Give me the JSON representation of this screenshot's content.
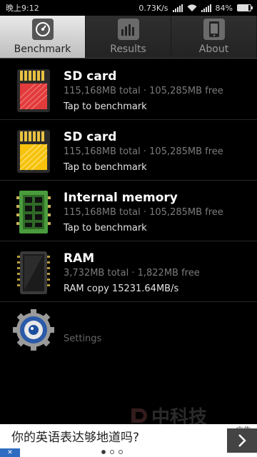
{
  "status_bar": {
    "time": "晚上9:12",
    "network_speed": "0.73K/s",
    "battery": "84%",
    "battery_level": 0.84
  },
  "tabs": [
    {
      "label": "Benchmark",
      "icon": "speedometer-icon",
      "active": true
    },
    {
      "label": "Results",
      "icon": "bar-chart-icon",
      "active": false
    },
    {
      "label": "About",
      "icon": "phone-icon",
      "active": false
    }
  ],
  "items": [
    {
      "title": "SD card",
      "detail": "115,168MB total · 105,285MB free",
      "action": "Tap to benchmark",
      "icon": "sd-card-red-icon",
      "color": "#e23b3b"
    },
    {
      "title": "SD card",
      "detail": "115,168MB total · 105,285MB free",
      "action": "Tap to benchmark",
      "icon": "sd-card-yellow-icon",
      "color": "#f6c20c"
    },
    {
      "title": "Internal memory",
      "detail": "115,168MB total · 105,285MB free",
      "action": "Tap to benchmark",
      "icon": "memory-chip-green-icon",
      "color": "#4a9b3d"
    },
    {
      "title": "RAM",
      "detail": "3,732MB total · 1,822MB free",
      "action": "RAM copy 15231.64MB/s",
      "icon": "ram-chip-icon",
      "color": "#333333"
    }
  ],
  "settings": {
    "label": "Settings",
    "icon": "gear-icon"
  },
  "watermark": {
    "text": "中科技"
  },
  "ad": {
    "text": "你的英语表达够地道吗?",
    "tag": "广告",
    "next_icon": "chevron-right-icon",
    "page_count": 3,
    "current_page": 1
  }
}
